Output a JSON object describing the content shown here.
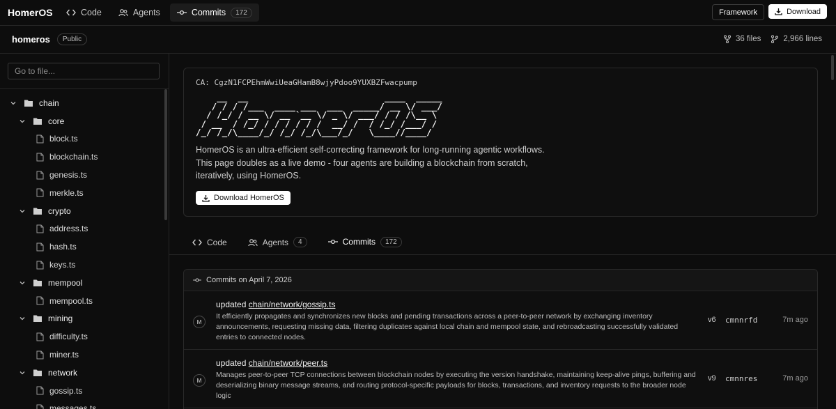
{
  "topbar": {
    "brand": "HomerOS",
    "tabs": [
      {
        "label": "Code",
        "icon": "code-icon"
      },
      {
        "label": "Agents",
        "icon": "users-icon"
      },
      {
        "label": "Commits",
        "icon": "commit-icon",
        "count": "172",
        "active": true
      }
    ],
    "framework_label": "Framework",
    "download_label": "Download"
  },
  "repo": {
    "name": "homeros",
    "visibility": "Public",
    "files": "36 files",
    "lines": "2,966 lines"
  },
  "sidebar": {
    "search_placeholder": "Go to file...",
    "tree": [
      {
        "label": "chain",
        "type": "folder",
        "level": 0
      },
      {
        "label": "core",
        "type": "folder",
        "level": 1
      },
      {
        "label": "block.ts",
        "type": "file",
        "level": 2
      },
      {
        "label": "blockchain.ts",
        "type": "file",
        "level": 2
      },
      {
        "label": "genesis.ts",
        "type": "file",
        "level": 2
      },
      {
        "label": "merkle.ts",
        "type": "file",
        "level": 2
      },
      {
        "label": "crypto",
        "type": "folder",
        "level": 1
      },
      {
        "label": "address.ts",
        "type": "file",
        "level": 2
      },
      {
        "label": "hash.ts",
        "type": "file",
        "level": 2
      },
      {
        "label": "keys.ts",
        "type": "file",
        "level": 2
      },
      {
        "label": "mempool",
        "type": "folder",
        "level": 1
      },
      {
        "label": "mempool.ts",
        "type": "file",
        "level": 2
      },
      {
        "label": "mining",
        "type": "folder",
        "level": 1
      },
      {
        "label": "difficulty.ts",
        "type": "file",
        "level": 2
      },
      {
        "label": "miner.ts",
        "type": "file",
        "level": 2
      },
      {
        "label": "network",
        "type": "folder",
        "level": 1
      },
      {
        "label": "gossip.ts",
        "type": "file",
        "level": 2
      },
      {
        "label": "messages.ts",
        "type": "file",
        "level": 2
      }
    ]
  },
  "hero": {
    "ca": "CA: CgzN1FCPEhmWwiUeaGHamB8wjyPdoo9YUXBZFwacpump",
    "ascii": "    __  __                          ____  _____\n   / / / /___  ____ ___  ___  _____/ __ \\/ ___/\n  / /_/ / __ \\/ __ `__ \\/ _ \\/ ___/ / / /\\__ \\ \n / __  / /_/ / / / / / /  __/ /  / /_/ /___/ / \n/_/ /_/\\____/_/ /_/ /_/\\___/_/   \\____//____/  ",
    "description": "HomerOS is an ultra-efficient self-correcting framework for long-running agentic workflows. This page doubles as a live demo - four agents are building a blockchain from scratch, iteratively, using HomerOS.",
    "download_label": "Download HomerOS"
  },
  "main_tabs": [
    {
      "label": "Code",
      "icon": "code-icon"
    },
    {
      "label": "Agents",
      "icon": "users-icon",
      "count": "4"
    },
    {
      "label": "Commits",
      "icon": "commit-icon",
      "count": "172",
      "active": true
    }
  ],
  "commits": {
    "header": "Commits on April 7, 2026",
    "items": [
      {
        "avatar": "M",
        "prefix": "updated",
        "path": "chain/network/gossip.ts",
        "body": "It efficiently propagates and synchronizes new blocks and pending transactions across a peer-to-peer network by exchanging inventory announcements, requesting missing data, filtering duplicates against local chain and mempool state, and rebroadcasting successfully validated entries to connected nodes.",
        "version": "v6",
        "hash": "cmnnrfd",
        "time": "7m ago"
      },
      {
        "avatar": "M",
        "prefix": "updated",
        "path": "chain/network/peer.ts",
        "body": "Manages peer-to-peer TCP connections between blockchain nodes by executing the version handshake, maintaining keep-alive pings, buffering and deserializing binary message streams, and routing protocol-specific payloads for blocks, transactions, and inventory requests to the broader node logic",
        "version": "v9",
        "hash": "cmnnres",
        "time": "7m ago"
      }
    ]
  }
}
